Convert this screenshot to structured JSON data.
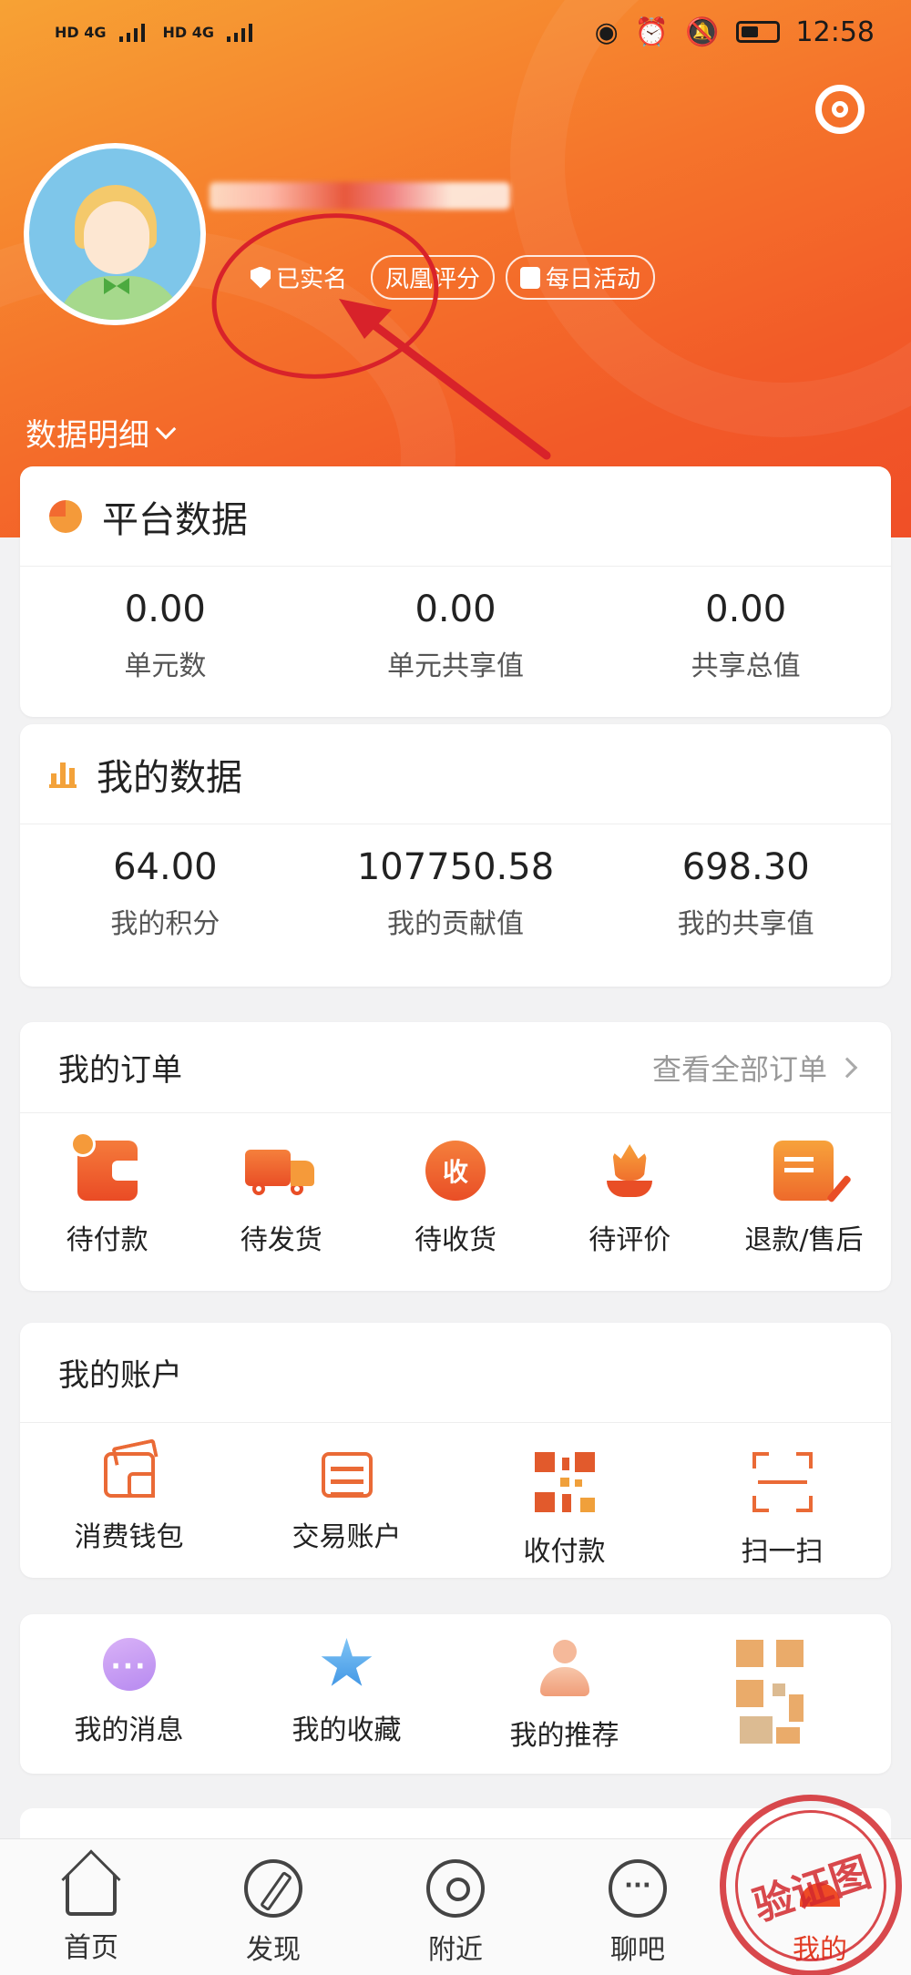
{
  "status_bar": {
    "network_1": "HD 4G",
    "network_2": "HD 4G",
    "time": "12:58"
  },
  "profile": {
    "username": "",
    "badges": [
      {
        "label": "已实名",
        "icon": "shield-check-icon"
      },
      {
        "label": "凤凰评分",
        "icon": ""
      },
      {
        "label": "每日活动",
        "icon": "calendar-icon"
      }
    ],
    "data_detail": "数据明细"
  },
  "platform_data": {
    "title": "平台数据",
    "stats": [
      {
        "value": "0.00",
        "label": "单元数"
      },
      {
        "value": "0.00",
        "label": "单元共享值"
      },
      {
        "value": "0.00",
        "label": "共享总值"
      }
    ]
  },
  "my_data": {
    "title": "我的数据",
    "stats": [
      {
        "value": "64.00",
        "label": "我的积分"
      },
      {
        "value": "107750.58",
        "label": "我的贡献值"
      },
      {
        "value": "698.30",
        "label": "我的共享值"
      }
    ]
  },
  "orders": {
    "title": "我的订单",
    "view_all": "查看全部订单",
    "items": [
      {
        "label": "待付款",
        "icon": "wallet-icon"
      },
      {
        "label": "待发货",
        "icon": "truck-icon"
      },
      {
        "label": "待收货",
        "icon": "receive-icon",
        "glyph": "收"
      },
      {
        "label": "待评价",
        "icon": "flower-icon"
      },
      {
        "label": "退款/售后",
        "icon": "note-edit-icon"
      }
    ]
  },
  "account": {
    "title": "我的账户",
    "items": [
      {
        "label": "消费钱包",
        "icon": "wallet-icon"
      },
      {
        "label": "交易账户",
        "icon": "card-icon"
      },
      {
        "label": "收付款",
        "icon": "qr-code-icon"
      },
      {
        "label": "扫一扫",
        "icon": "scan-icon"
      }
    ]
  },
  "tools": {
    "items": [
      {
        "label": "我的消息",
        "icon": "message-icon"
      },
      {
        "label": "我的收藏",
        "icon": "star-icon"
      },
      {
        "label": "我的推荐",
        "icon": "person-icon"
      }
    ]
  },
  "nav": {
    "items": [
      {
        "label": "首页",
        "icon": "home-icon"
      },
      {
        "label": "发现",
        "icon": "compass-icon"
      },
      {
        "label": "附近",
        "icon": "location-icon"
      },
      {
        "label": "聊吧",
        "icon": "chat-icon"
      },
      {
        "label": "我的",
        "icon": "profile-icon",
        "active": true
      }
    ]
  },
  "stamp_text": "验证图",
  "colors": {
    "brand_orange": "#f5742b",
    "active_red": "#e23c24",
    "annotation_red": "#d8222a"
  }
}
